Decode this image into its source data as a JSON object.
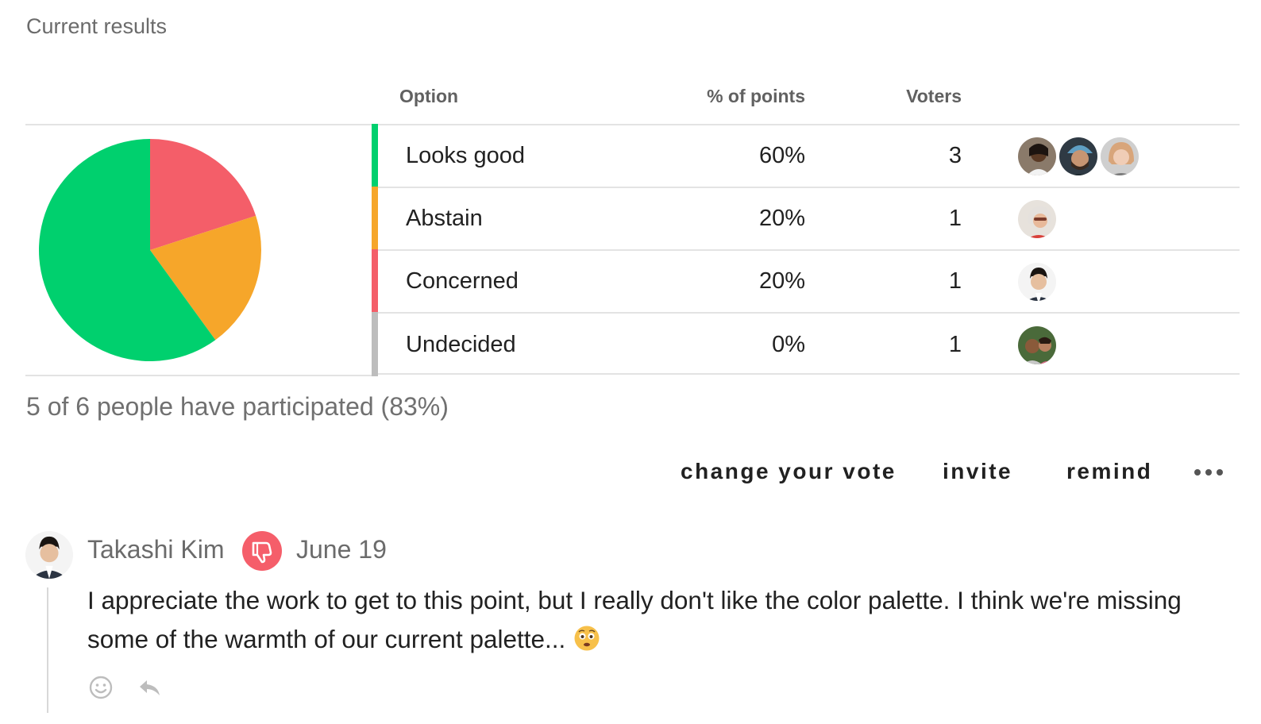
{
  "title": "Current results",
  "table": {
    "headers": {
      "option": "Option",
      "points": "% of points",
      "voters": "Voters"
    },
    "rows": [
      {
        "option": "Looks good",
        "points": "60%",
        "voters": "3",
        "color": "#00d06e"
      },
      {
        "option": "Abstain",
        "points": "20%",
        "voters": "1",
        "color": "#f6a62a"
      },
      {
        "option": "Concerned",
        "points": "20%",
        "voters": "1",
        "color": "#f45e69"
      },
      {
        "option": "Undecided",
        "points": "0%",
        "voters": "1",
        "color": "#bdbdbd"
      }
    ]
  },
  "chart_data": {
    "type": "pie",
    "categories": [
      "Looks good",
      "Abstain",
      "Concerned"
    ],
    "values": [
      60,
      20,
      20
    ],
    "colors": [
      "#00d06e",
      "#f6a62a",
      "#f45e69"
    ]
  },
  "participation": "5 of 6 people have participated (83%)",
  "actions": {
    "change_vote": "change your vote",
    "invite": "invite",
    "remind": "remind",
    "more_icon": "more-horizontal-icon"
  },
  "comment": {
    "author": "Takashi Kim",
    "stance_icon": "thumbs-down-icon",
    "date": "June 19",
    "body": "I appreciate the work to get to this point, but I really don't like the color palette. I think we're missing some of the warmth of our current palette...",
    "emoji_icon": "worried-face-icon",
    "react_icon": "smiley-icon",
    "reply_icon": "reply-icon"
  }
}
